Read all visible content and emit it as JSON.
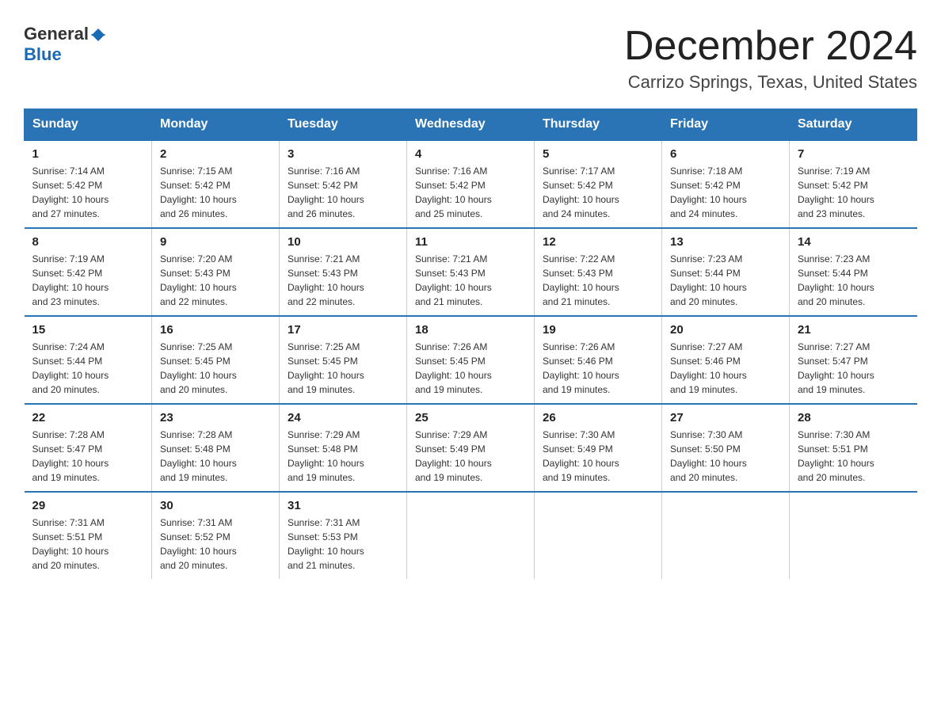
{
  "logo": {
    "general": "General",
    "blue": "Blue"
  },
  "header": {
    "month": "December 2024",
    "location": "Carrizo Springs, Texas, United States"
  },
  "days_of_week": [
    "Sunday",
    "Monday",
    "Tuesday",
    "Wednesday",
    "Thursday",
    "Friday",
    "Saturday"
  ],
  "weeks": [
    [
      {
        "day": "1",
        "sunrise": "7:14 AM",
        "sunset": "5:42 PM",
        "daylight": "10 hours and 27 minutes."
      },
      {
        "day": "2",
        "sunrise": "7:15 AM",
        "sunset": "5:42 PM",
        "daylight": "10 hours and 26 minutes."
      },
      {
        "day": "3",
        "sunrise": "7:16 AM",
        "sunset": "5:42 PM",
        "daylight": "10 hours and 26 minutes."
      },
      {
        "day": "4",
        "sunrise": "7:16 AM",
        "sunset": "5:42 PM",
        "daylight": "10 hours and 25 minutes."
      },
      {
        "day": "5",
        "sunrise": "7:17 AM",
        "sunset": "5:42 PM",
        "daylight": "10 hours and 24 minutes."
      },
      {
        "day": "6",
        "sunrise": "7:18 AM",
        "sunset": "5:42 PM",
        "daylight": "10 hours and 24 minutes."
      },
      {
        "day": "7",
        "sunrise": "7:19 AM",
        "sunset": "5:42 PM",
        "daylight": "10 hours and 23 minutes."
      }
    ],
    [
      {
        "day": "8",
        "sunrise": "7:19 AM",
        "sunset": "5:42 PM",
        "daylight": "10 hours and 23 minutes."
      },
      {
        "day": "9",
        "sunrise": "7:20 AM",
        "sunset": "5:43 PM",
        "daylight": "10 hours and 22 minutes."
      },
      {
        "day": "10",
        "sunrise": "7:21 AM",
        "sunset": "5:43 PM",
        "daylight": "10 hours and 22 minutes."
      },
      {
        "day": "11",
        "sunrise": "7:21 AM",
        "sunset": "5:43 PM",
        "daylight": "10 hours and 21 minutes."
      },
      {
        "day": "12",
        "sunrise": "7:22 AM",
        "sunset": "5:43 PM",
        "daylight": "10 hours and 21 minutes."
      },
      {
        "day": "13",
        "sunrise": "7:23 AM",
        "sunset": "5:44 PM",
        "daylight": "10 hours and 20 minutes."
      },
      {
        "day": "14",
        "sunrise": "7:23 AM",
        "sunset": "5:44 PM",
        "daylight": "10 hours and 20 minutes."
      }
    ],
    [
      {
        "day": "15",
        "sunrise": "7:24 AM",
        "sunset": "5:44 PM",
        "daylight": "10 hours and 20 minutes."
      },
      {
        "day": "16",
        "sunrise": "7:25 AM",
        "sunset": "5:45 PM",
        "daylight": "10 hours and 20 minutes."
      },
      {
        "day": "17",
        "sunrise": "7:25 AM",
        "sunset": "5:45 PM",
        "daylight": "10 hours and 19 minutes."
      },
      {
        "day": "18",
        "sunrise": "7:26 AM",
        "sunset": "5:45 PM",
        "daylight": "10 hours and 19 minutes."
      },
      {
        "day": "19",
        "sunrise": "7:26 AM",
        "sunset": "5:46 PM",
        "daylight": "10 hours and 19 minutes."
      },
      {
        "day": "20",
        "sunrise": "7:27 AM",
        "sunset": "5:46 PM",
        "daylight": "10 hours and 19 minutes."
      },
      {
        "day": "21",
        "sunrise": "7:27 AM",
        "sunset": "5:47 PM",
        "daylight": "10 hours and 19 minutes."
      }
    ],
    [
      {
        "day": "22",
        "sunrise": "7:28 AM",
        "sunset": "5:47 PM",
        "daylight": "10 hours and 19 minutes."
      },
      {
        "day": "23",
        "sunrise": "7:28 AM",
        "sunset": "5:48 PM",
        "daylight": "10 hours and 19 minutes."
      },
      {
        "day": "24",
        "sunrise": "7:29 AM",
        "sunset": "5:48 PM",
        "daylight": "10 hours and 19 minutes."
      },
      {
        "day": "25",
        "sunrise": "7:29 AM",
        "sunset": "5:49 PM",
        "daylight": "10 hours and 19 minutes."
      },
      {
        "day": "26",
        "sunrise": "7:30 AM",
        "sunset": "5:49 PM",
        "daylight": "10 hours and 19 minutes."
      },
      {
        "day": "27",
        "sunrise": "7:30 AM",
        "sunset": "5:50 PM",
        "daylight": "10 hours and 20 minutes."
      },
      {
        "day": "28",
        "sunrise": "7:30 AM",
        "sunset": "5:51 PM",
        "daylight": "10 hours and 20 minutes."
      }
    ],
    [
      {
        "day": "29",
        "sunrise": "7:31 AM",
        "sunset": "5:51 PM",
        "daylight": "10 hours and 20 minutes."
      },
      {
        "day": "30",
        "sunrise": "7:31 AM",
        "sunset": "5:52 PM",
        "daylight": "10 hours and 20 minutes."
      },
      {
        "day": "31",
        "sunrise": "7:31 AM",
        "sunset": "5:53 PM",
        "daylight": "10 hours and 21 minutes."
      },
      null,
      null,
      null,
      null
    ]
  ],
  "labels": {
    "sunrise": "Sunrise:",
    "sunset": "Sunset:",
    "daylight": "Daylight:"
  }
}
